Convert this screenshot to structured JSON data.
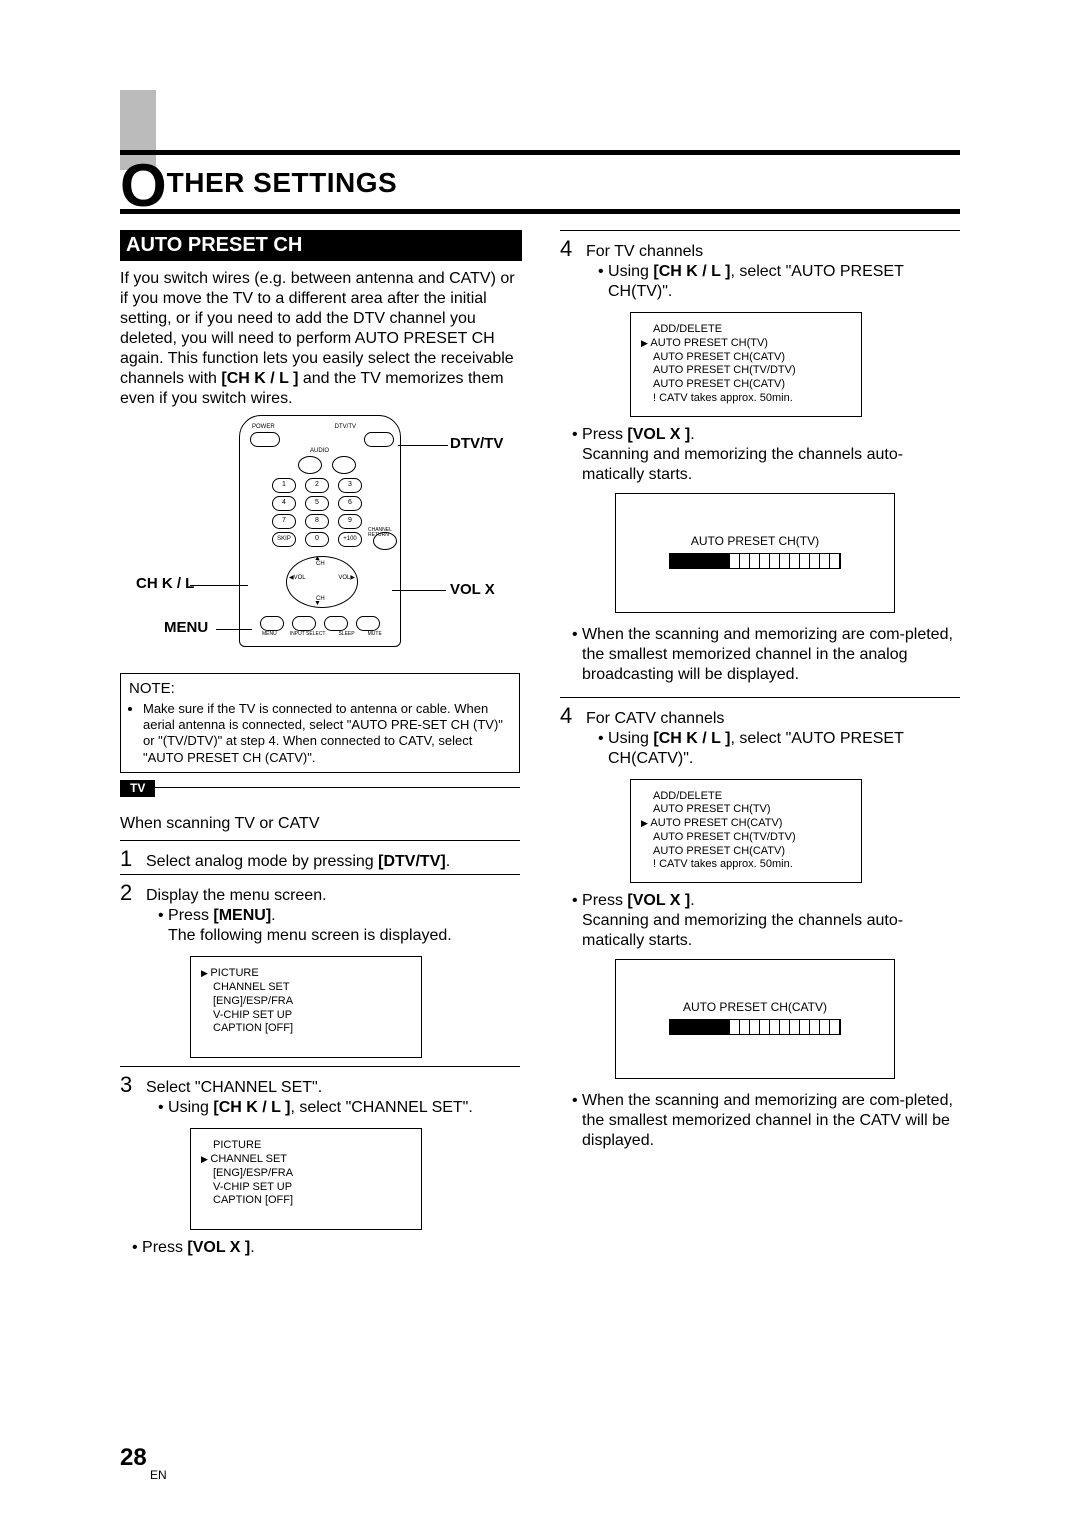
{
  "chapter": {
    "first_letter": "O",
    "rest": "THER SETTINGS"
  },
  "section": {
    "title": "AUTO PRESET CH"
  },
  "intro": {
    "p1a": "If you switch wires (e.g. between antenna and CATV) or if you move the TV to a different area after the initial setting, or if you need to add the DTV channel you deleted, you will need to perform AUTO PRESET CH again. This function lets you easily select the receivable channels with ",
    "p1b_bold": "[CH K / L ]",
    "p1c": " and the TV memorizes them even if you switch wires."
  },
  "remote_labels": {
    "dtv": "DTV/TV",
    "ch": "CH K / L",
    "vol": "VOL X",
    "menu": "MENU"
  },
  "remote_buttons": {
    "power": "POWER",
    "dtvtv": "DTV/TV",
    "audio": "AUDIO",
    "n1": "1",
    "n2": "2",
    "n3": "3",
    "n4": "4",
    "n5": "5",
    "n6": "6",
    "n7": "7",
    "n8": "8",
    "n9": "9",
    "n0": "0",
    "skip": "SKIP",
    "plus100": "+100",
    "chret": "CHANNEL RETURN",
    "volL": "VOL",
    "chU": "CH",
    "volR": "VOL",
    "chD": "CH",
    "menu": "MENU",
    "input": "INPUT SELECT",
    "sleep": "SLEEP",
    "mute": "MUTE"
  },
  "note": {
    "heading": "NOTE:",
    "bullet": "Make sure if the TV is connected to antenna or cable. When aerial antenna is connected, select \"AUTO PRE-SET CH (TV)\" or \"(TV/DTV)\" at step 4. When connected to CATV, select \"AUTO PRESET CH (CATV)\"."
  },
  "tv_tag": "TV",
  "scan_intro": "When scanning TV or CATV",
  "steps": {
    "s1": {
      "num": "1",
      "text_a": "Select analog mode by pressing ",
      "text_b_bold": "[DTV/TV]",
      "text_c": "."
    },
    "s2": {
      "num": "2",
      "line1": "Display the menu screen.",
      "b1a": "• Press ",
      "b1b_bold": "[MENU]",
      "b1c": ".",
      "line2": "The following menu screen is displayed."
    },
    "menu1": {
      "l1": "PICTURE",
      "l2": "CHANNEL SET",
      "l3": "[ENG]/ESP/FRA",
      "l4": "V-CHIP SET UP",
      "l5": "CAPTION [OFF]"
    },
    "s3": {
      "num": "3",
      "line1": "Select \"CHANNEL SET\".",
      "b1a": "• Using ",
      "b1b_bold": "[CH K / L ]",
      "b1c": ", select \"CHANNEL SET\"."
    },
    "menu2": {
      "l1": "PICTURE",
      "l2": "CHANNEL SET",
      "l3": "[ENG]/ESP/FRA",
      "l4": "V-CHIP SET UP",
      "l5": "CAPTION [OFF]"
    },
    "press_vol": {
      "a": "• Press ",
      "b_bold": "[VOL X ]",
      "c": "."
    }
  },
  "right": {
    "s4tv": {
      "num": "4",
      "title": "For TV channels",
      "b1a": "• Using ",
      "b1b_bold": "[CH K / L ]",
      "b1c": ", select \"AUTO PRESET CH(TV)\"."
    },
    "menu_tv": {
      "l1": "ADD/DELETE",
      "l2": "AUTO PRESET CH(TV)",
      "l3": "AUTO PRESET CH(CATV)",
      "l4": "AUTO PRESET CH(TV/DTV)",
      "l5": "AUTO PRESET CH(CATV)",
      "l6": "! CATV takes approx. 50min."
    },
    "press_vol_tv": {
      "a": "• Press ",
      "b_bold": "[VOL X ]",
      "c": "."
    },
    "scan_tv": "Scanning and memorizing the channels auto-matically starts.",
    "progress_tv_label": "AUTO PRESET CH(TV)",
    "done_tv": "• When the scanning and memorizing are com-pleted, the smallest memorized channel in the analog broadcasting will be displayed.",
    "s4catv": {
      "num": "4",
      "title": "For CATV channels",
      "b1a": "• Using ",
      "b1b_bold": "[CH K / L ]",
      "b1c": ", select \"AUTO PRESET CH(CATV)\"."
    },
    "menu_catv": {
      "l1": "ADD/DELETE",
      "l2": "AUTO PRESET CH(TV)",
      "l3": "AUTO PRESET CH(CATV)",
      "l4": "AUTO PRESET CH(TV/DTV)",
      "l5": "AUTO PRESET CH(CATV)",
      "l6": "! CATV takes approx. 50min."
    },
    "press_vol_catv": {
      "a": "• Press ",
      "b_bold": "[VOL X ]",
      "c": "."
    },
    "scan_catv": "Scanning and memorizing the channels auto-matically starts.",
    "progress_catv_label": "AUTO PRESET CH(CATV)",
    "done_catv": "• When the scanning and memorizing are com-pleted, the smallest memorized channel in the CATV will be displayed."
  },
  "footer": {
    "page": "28",
    "lang": "EN"
  }
}
